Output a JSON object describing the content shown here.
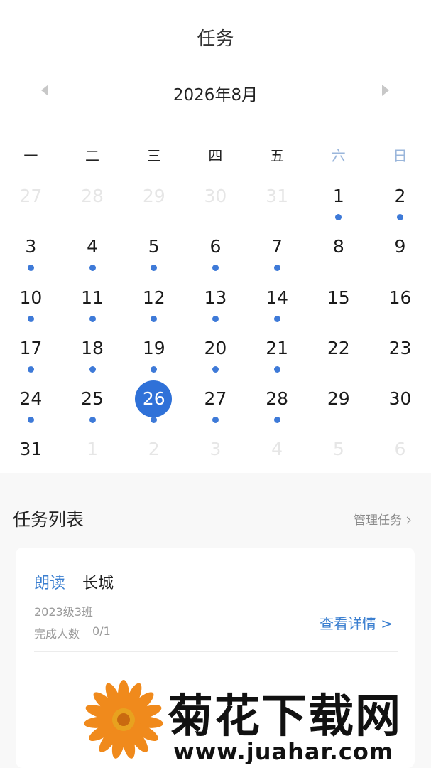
{
  "header": {
    "title": "任务"
  },
  "calendar": {
    "month_label": "2026年8月",
    "weekdays": [
      "一",
      "二",
      "三",
      "四",
      "五",
      "六",
      "日"
    ],
    "weeks": [
      [
        {
          "d": "27",
          "other": true
        },
        {
          "d": "28",
          "other": true
        },
        {
          "d": "29",
          "other": true
        },
        {
          "d": "30",
          "other": true
        },
        {
          "d": "31",
          "other": true
        },
        {
          "d": "1",
          "dot": true
        },
        {
          "d": "2",
          "dot": true
        }
      ],
      [
        {
          "d": "3",
          "dot": true
        },
        {
          "d": "4",
          "dot": true
        },
        {
          "d": "5",
          "dot": true
        },
        {
          "d": "6",
          "dot": true
        },
        {
          "d": "7",
          "dot": true
        },
        {
          "d": "8"
        },
        {
          "d": "9"
        }
      ],
      [
        {
          "d": "10",
          "dot": true
        },
        {
          "d": "11",
          "dot": true
        },
        {
          "d": "12",
          "dot": true
        },
        {
          "d": "13",
          "dot": true
        },
        {
          "d": "14",
          "dot": true
        },
        {
          "d": "15"
        },
        {
          "d": "16"
        }
      ],
      [
        {
          "d": "17",
          "dot": true
        },
        {
          "d": "18",
          "dot": true
        },
        {
          "d": "19",
          "dot": true
        },
        {
          "d": "20",
          "dot": true
        },
        {
          "d": "21",
          "dot": true
        },
        {
          "d": "22"
        },
        {
          "d": "23"
        }
      ],
      [
        {
          "d": "24",
          "dot": true
        },
        {
          "d": "25",
          "dot": true
        },
        {
          "d": "26",
          "dot": true,
          "selected": true
        },
        {
          "d": "27",
          "dot": true
        },
        {
          "d": "28",
          "dot": true
        },
        {
          "d": "29"
        },
        {
          "d": "30"
        }
      ],
      [
        {
          "d": "31"
        },
        {
          "d": "1",
          "other": true
        },
        {
          "d": "2",
          "other": true
        },
        {
          "d": "3",
          "other": true
        },
        {
          "d": "4",
          "other": true
        },
        {
          "d": "5",
          "other": true
        },
        {
          "d": "6",
          "other": true
        }
      ]
    ],
    "colors": {
      "selected": "#2f71d8",
      "dot": "#3e7ad8",
      "weekend_header": "#9ab6db"
    }
  },
  "tasks": {
    "title": "任务列表",
    "manage_label": "管理任务",
    "items": [
      {
        "type": "朗读",
        "name": "长城",
        "class_name": "2023级3班",
        "progress_label": "完成人数",
        "progress_value": "0/1",
        "detail_label": "查看详情 >"
      }
    ]
  },
  "watermark": {
    "text": "菊花下载网",
    "url": "www.juahar.com"
  }
}
